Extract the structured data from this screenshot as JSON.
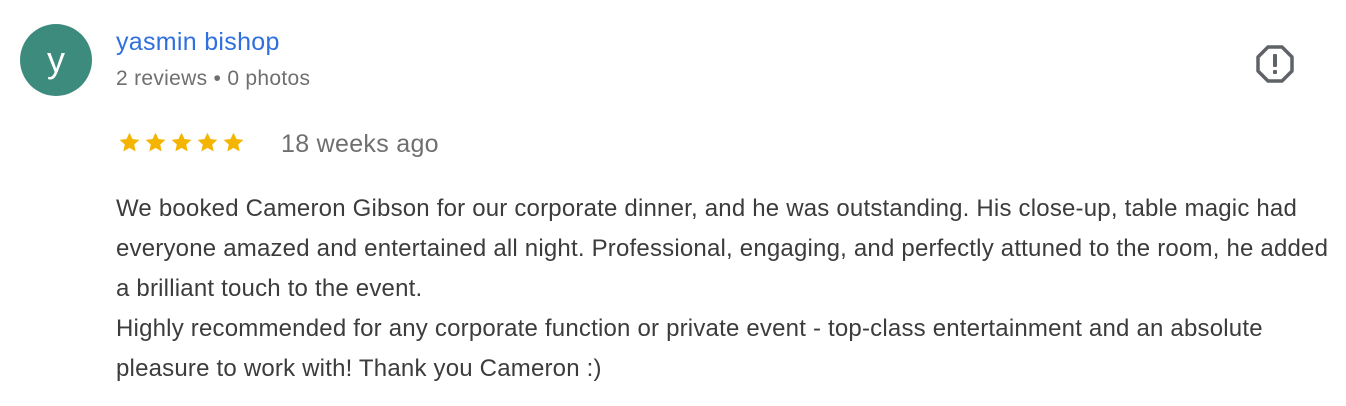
{
  "reviewer": {
    "avatar_letter": "y",
    "name": "yasmin bishop",
    "meta": "2 reviews • 0 photos"
  },
  "rating": {
    "stars_filled": 5,
    "stars_total": 5,
    "star_color": "#f4b400",
    "date": "18 weeks ago"
  },
  "review": {
    "paragraph_1": "We booked Cameron Gibson for our corporate dinner, and he was outstanding. His close-up, table magic had everyone amazed and entertained all night. Professional, engaging, and perfectly attuned to the room, he added a brilliant touch to the event.",
    "paragraph_2": "Highly recommended for any corporate function or private event - top-class entertainment and an absolute pleasure to work with! Thank you Cameron :)"
  },
  "icons": {
    "report": "report-icon",
    "star": "star-icon"
  },
  "colors": {
    "avatar_bg": "#3d8b7c",
    "name_link": "#2f6fde"
  }
}
